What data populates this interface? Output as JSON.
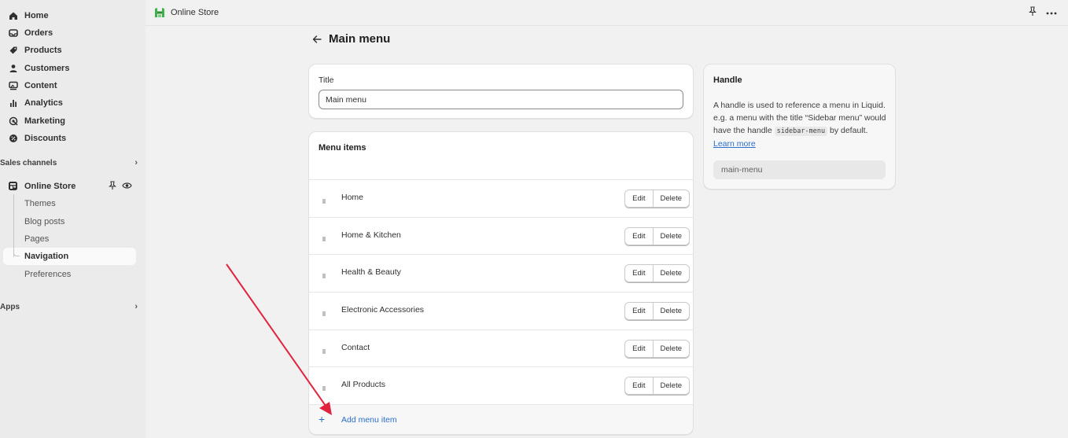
{
  "sidebar": {
    "main": [
      {
        "label": "Home",
        "icon": "home-icon"
      },
      {
        "label": "Orders",
        "icon": "inbox-icon"
      },
      {
        "label": "Products",
        "icon": "tag-icon"
      },
      {
        "label": "Customers",
        "icon": "person-icon"
      },
      {
        "label": "Content",
        "icon": "image-icon"
      },
      {
        "label": "Analytics",
        "icon": "bar-chart-icon"
      },
      {
        "label": "Marketing",
        "icon": "target-icon"
      },
      {
        "label": "Discounts",
        "icon": "discount-icon"
      }
    ],
    "sales_channels_label": "Sales channels",
    "online_store_label": "Online Store",
    "sub_items": [
      {
        "label": "Themes"
      },
      {
        "label": "Blog posts"
      },
      {
        "label": "Pages"
      },
      {
        "label": "Navigation"
      },
      {
        "label": "Preferences"
      }
    ],
    "active_sub_item": "Navigation",
    "apps_label": "Apps"
  },
  "topbar": {
    "app_name": "Online Store",
    "brand_color": "#3fb24b"
  },
  "page": {
    "title": "Main menu"
  },
  "title_card": {
    "label": "Title",
    "value": "Main menu"
  },
  "menu_items": {
    "heading": "Menu items",
    "items": [
      {
        "label": "Home"
      },
      {
        "label": "Home & Kitchen"
      },
      {
        "label": "Health & Beauty"
      },
      {
        "label": "Electronic Accessories"
      },
      {
        "label": "Contact"
      },
      {
        "label": "All Products"
      }
    ],
    "edit_label": "Edit",
    "delete_label": "Delete",
    "add_label": "Add menu item"
  },
  "handle": {
    "heading": "Handle",
    "desc_1": "A handle is used to reference a menu in Liquid. e.g. a menu with the title “Sidebar menu” would have the handle",
    "code": "sidebar-menu",
    "desc_2": "by default.",
    "learn_more": "Learn more",
    "value": "main-menu"
  },
  "colors": {
    "link": "#2c6ecb",
    "annotation_arrow": "#e0243f"
  }
}
